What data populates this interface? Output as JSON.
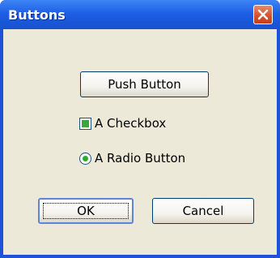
{
  "window": {
    "title": "Buttons",
    "close_icon": "close-icon"
  },
  "buttons": {
    "push_label": "Push Button",
    "ok_label": "OK",
    "cancel_label": "Cancel"
  },
  "checkbox": {
    "label": "A Checkbox",
    "state": "partially-checked"
  },
  "radio": {
    "label": "A Radio Button",
    "checked": true
  },
  "colors": {
    "titlebar": "#1e5fe6",
    "close_button": "#d6542f",
    "client": "#ece9d8",
    "check_green": "#3ea53e"
  }
}
